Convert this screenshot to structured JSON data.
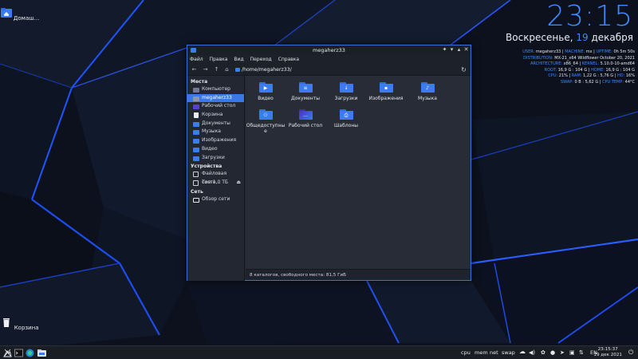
{
  "desktop": {
    "icons": [
      {
        "label": "Домаш...",
        "icon": "home-folder-icon"
      },
      {
        "label": "Корзина",
        "icon": "trash-icon"
      }
    ]
  },
  "clock_widget": {
    "time": "23:15",
    "day": "Воскресенье,",
    "date_num": "19",
    "month": "декабря",
    "accent": "#3d8bff"
  },
  "sysinfo": {
    "line1": {
      "k1": "USER:",
      "v1": "megaherz33 |",
      "k2": "MACHINE:",
      "v2": "mx |",
      "k3": "UPTIME:",
      "v3": "0h 5m 50s"
    },
    "line2": {
      "k1": "DISTRIBUTION:",
      "v1": "MX-21_x64 Wildflower October 20, 2021"
    },
    "line3": {
      "k1": "ARCHITECTURE:",
      "v1": "x86_64 |",
      "k2": "KERNEL:",
      "v2": "5.10.0-10-amd64"
    },
    "line4": {
      "k1": "ROOT:",
      "v1": "16,9 G : 104 G |",
      "k2": "HOME:",
      "v2": "16,9 G : 104 G"
    },
    "line5": {
      "k1": "CPU:",
      "v1": "21% |",
      "k2": "RAM:",
      "v2": "1,22 G : 5,76 G |",
      "k3": "HD:",
      "v3": "16%"
    },
    "line6": {
      "k1": "SWAP:",
      "v1": "0 B : 5,62 G |",
      "k2": "CPU TEMP:",
      "v2": "44°C"
    }
  },
  "window": {
    "title": "megaherz33",
    "menu": [
      "Файл",
      "Правка",
      "Вид",
      "Переход",
      "Справка"
    ],
    "path": "/home/megaherz33/",
    "sidebar": {
      "places_header": "Места",
      "places": [
        {
          "label": "Компьютер",
          "icon": "computer-icon"
        },
        {
          "label": "megaherz33",
          "icon": "home-icon",
          "selected": true
        },
        {
          "label": "Рабочий стол",
          "icon": "desktop-icon"
        },
        {
          "label": "Корзина",
          "icon": "trash-icon"
        },
        {
          "label": "Документы",
          "icon": "documents-icon"
        },
        {
          "label": "Музыка",
          "icon": "music-icon"
        },
        {
          "label": "Изображения",
          "icon": "pictures-icon"
        },
        {
          "label": "Видео",
          "icon": "videos-icon"
        },
        {
          "label": "Загрузки",
          "icon": "downloads-icon"
        }
      ],
      "devices_header": "Устройства",
      "devices": [
        {
          "label": "Файловая систе...",
          "icon": "filesystem-icon"
        },
        {
          "label": "Том 1,0 ТБ",
          "icon": "volume-icon"
        }
      ],
      "network_header": "Сеть",
      "network": [
        {
          "label": "Обзор сети",
          "icon": "network-icon"
        }
      ]
    },
    "folders": [
      {
        "label": "Видео",
        "sym": "▶"
      },
      {
        "label": "Документы",
        "sym": "≡"
      },
      {
        "label": "Загрузки",
        "sym": "↓"
      },
      {
        "label": "Изображения",
        "sym": "▪"
      },
      {
        "label": "Музыка",
        "sym": "♪"
      },
      {
        "label": "Общедоступны",
        "label2": "е",
        "sym": "⚇"
      },
      {
        "label": "Рабочий стол",
        "sym": "…"
      },
      {
        "label": "Шаблоны",
        "sym": "⎙"
      }
    ],
    "status": "8 каталогов, свободного места: 81,5 ГиБ"
  },
  "taskbar": {
    "monitors": [
      "cpu",
      "mem",
      "net",
      "swap"
    ],
    "lang": "EN",
    "time": "23:15:37",
    "date": "19 дек 2021"
  }
}
